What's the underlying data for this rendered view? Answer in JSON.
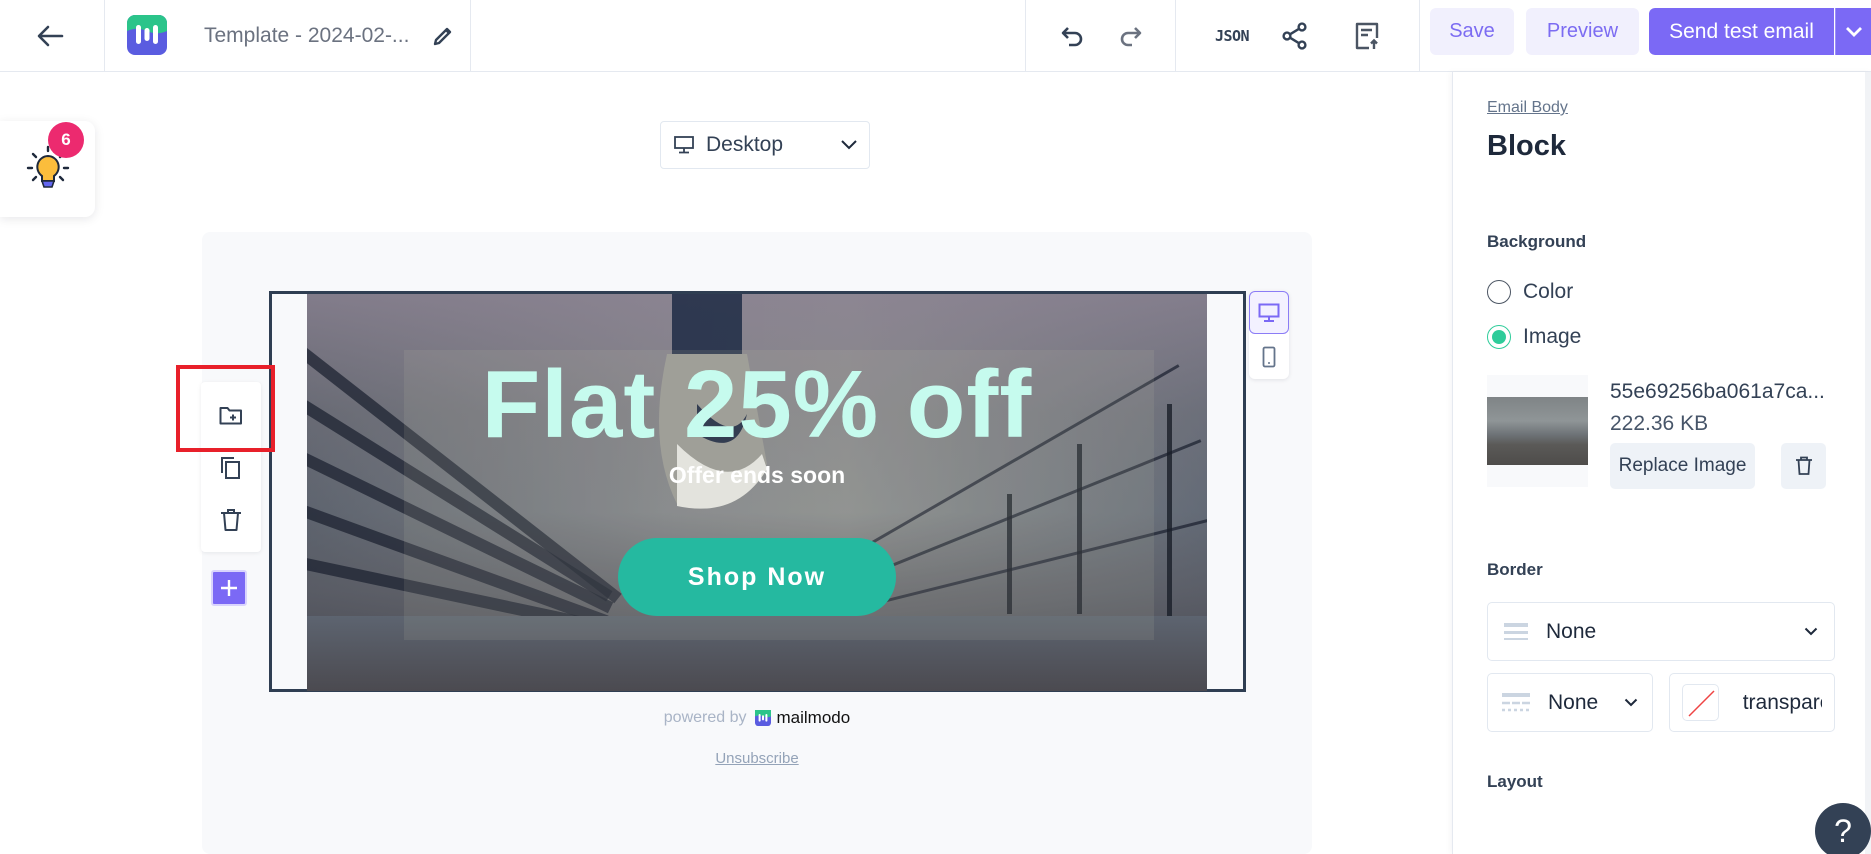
{
  "header": {
    "back_icon": "arrow-left-icon",
    "logo_icon": "mailmodo-logo",
    "template_title": "Template - 2024-02-...",
    "edit_icon": "pencil-icon",
    "undo_icon": "undo-icon",
    "redo_icon": "redo-icon",
    "json_label": "JSON",
    "share_icon": "share-icon",
    "export_icon": "document-upload-icon",
    "save_label": "Save",
    "preview_label": "Preview",
    "send_test_label": "Send test email",
    "send_menu_icon": "chevron-down-icon",
    "accent_color": "#7b69f5"
  },
  "tips": {
    "icon": "lightbulb-icon",
    "badge_count": "6"
  },
  "canvas": {
    "device_select": {
      "icon": "monitor-icon",
      "value": "Desktop"
    },
    "view_toggle": {
      "options": [
        "desktop",
        "mobile"
      ],
      "selected": "desktop"
    },
    "block_tools": [
      {
        "name": "save-block",
        "icon": "folder-plus-icon"
      },
      {
        "name": "duplicate-block",
        "icon": "copy-icon"
      },
      {
        "name": "delete-block",
        "icon": "trash-icon"
      }
    ],
    "add_block_icon": "plus-icon",
    "hero": {
      "title": "Flat 25% off",
      "subtitle": "Offer ends soon",
      "cta_label": "Shop Now",
      "title_color": "#c6fbee",
      "cta_color": "#25b9a0"
    },
    "footer": {
      "powered_by": "powered by",
      "brand": "mailmodo",
      "unsubscribe": "Unsubscribe"
    }
  },
  "panel": {
    "breadcrumb": "Email Body",
    "title": "Block",
    "background": {
      "label": "Background",
      "options": [
        {
          "label": "Color",
          "checked": false
        },
        {
          "label": "Image",
          "checked": true
        }
      ],
      "image": {
        "file_name": "55e69256ba061a7ca...",
        "file_size": "222.36 KB",
        "replace_label": "Replace Image",
        "delete_icon": "trash-icon"
      }
    },
    "border": {
      "label": "Border",
      "style_value": "None",
      "width_value": "None",
      "color_value": "transparent"
    },
    "layout": {
      "label": "Layout"
    },
    "help_label": "?"
  }
}
